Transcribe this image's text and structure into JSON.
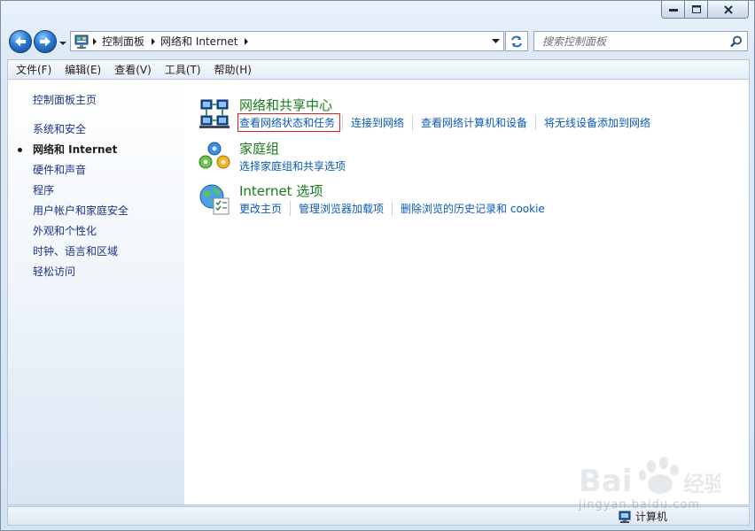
{
  "window": {
    "controls": {
      "minimize": "minimize",
      "maximize": "maximize",
      "close": "close"
    }
  },
  "address": {
    "crumbs": [
      "控制面板",
      "网络和 Internet"
    ]
  },
  "search": {
    "placeholder": "搜索控制面板"
  },
  "menu": [
    "文件(F)",
    "编辑(E)",
    "查看(V)",
    "工具(T)",
    "帮助(H)"
  ],
  "sidebar": {
    "home": "控制面板主页",
    "items": [
      {
        "label": "系统和安全",
        "active": false
      },
      {
        "label": "网络和 Internet",
        "active": true
      },
      {
        "label": "硬件和声音",
        "active": false
      },
      {
        "label": "程序",
        "active": false
      },
      {
        "label": "用户帐户和家庭安全",
        "active": false
      },
      {
        "label": "外观和个性化",
        "active": false
      },
      {
        "label": "时钟、语言和区域",
        "active": false
      },
      {
        "label": "轻松访问",
        "active": false
      }
    ]
  },
  "categories": [
    {
      "title": "网络和共享中心",
      "icon": "network-sharing-center-icon",
      "links": [
        "查看网络状态和任务",
        "连接到网络",
        "查看网络计算机和设备",
        "将无线设备添加到网络"
      ],
      "highlighted_link": "查看网络状态和任务"
    },
    {
      "title": "家庭组",
      "icon": "homegroup-icon",
      "links": [
        "选择家庭组和共享选项"
      ]
    },
    {
      "title": "Internet 选项",
      "icon": "internet-options-icon",
      "links": [
        "更改主页",
        "管理浏览器加载项",
        "删除浏览的历史记录和 cookie"
      ]
    }
  ],
  "status": {
    "computer_label": "计算机"
  },
  "watermark": {
    "text": "Baidu经验",
    "subtext": "jingyan.baidu.com"
  },
  "colors": {
    "link": "#0b5ab7",
    "category_title": "#187a1f",
    "highlight_box": "#e02020"
  }
}
